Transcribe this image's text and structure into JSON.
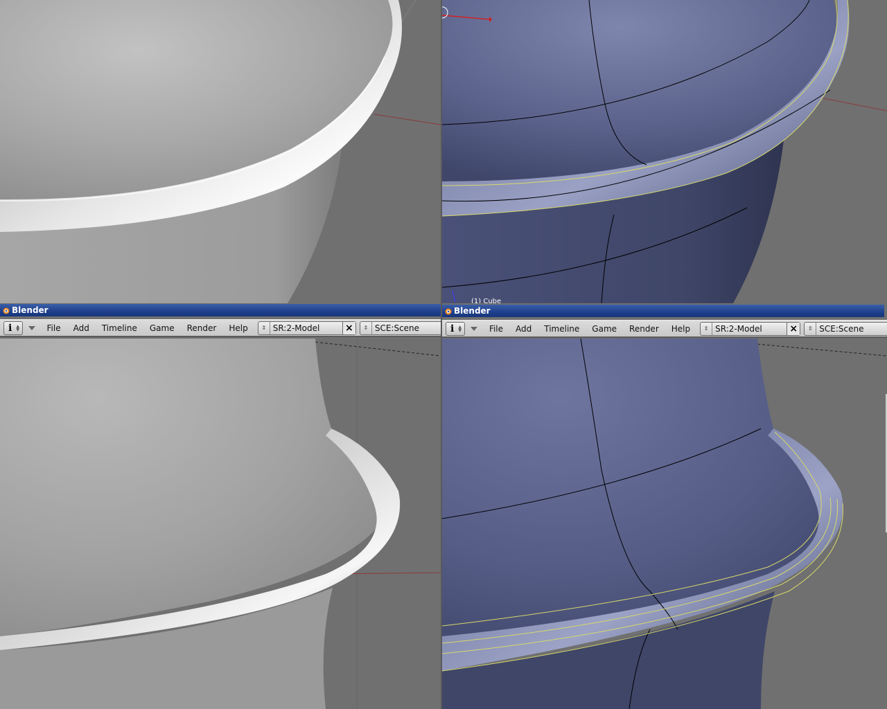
{
  "panes": {
    "left": {
      "window_title": "Blender",
      "menu": {
        "items": [
          "File",
          "Add",
          "Timeline",
          "Game",
          "Render",
          "Help"
        ],
        "screen_value": "SR:2-Model",
        "scene_value": "SCE:Scene"
      }
    },
    "right": {
      "window_title": "Blender",
      "object_info": "(1) Cube",
      "menu": {
        "items": [
          "File",
          "Add",
          "Timeline",
          "Game",
          "Render",
          "Help"
        ],
        "screen_value": "SR:2-Model",
        "scene_value": "SCE:Scene"
      }
    }
  },
  "colors": {
    "grey_model": "#bdbdbd",
    "blue_model": "#5a628a",
    "viewport_bg": "#737373",
    "title_bar": "#1f3f8c",
    "edge_select": "#d9d96a"
  },
  "icons": [
    "blender-logo-icon",
    "info-icon",
    "dropdown-triangle-icon",
    "updown-arrows-icon",
    "close-x-icon",
    "axis-arrow-icon"
  ]
}
